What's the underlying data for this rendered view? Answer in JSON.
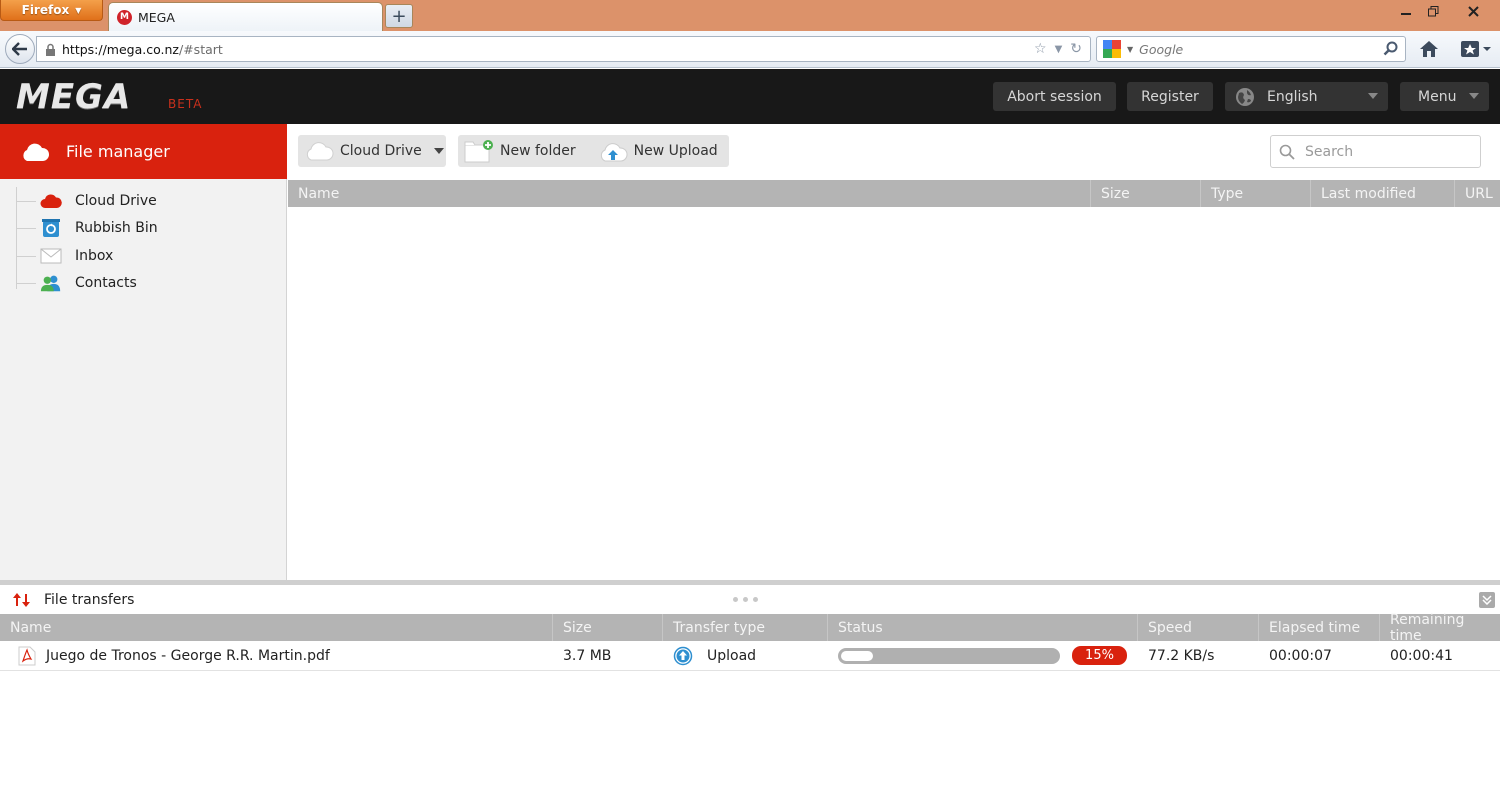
{
  "browser": {
    "menu_button": "Firefox",
    "tab_title": "MEGA",
    "tab_favicon": "M",
    "new_tab": "+",
    "url_host": "https://mega.co.nz",
    "url_path": "/#start",
    "search_placeholder": "Google"
  },
  "header": {
    "logo": "MEGA",
    "beta": "BETA",
    "abort_session": "Abort session",
    "register": "Register",
    "language": "English",
    "menu": "Menu"
  },
  "sidebar": {
    "title": "File manager",
    "items": [
      {
        "label": "Cloud Drive",
        "icon": "cloud-icon"
      },
      {
        "label": "Rubbish Bin",
        "icon": "recycle-icon"
      },
      {
        "label": "Inbox",
        "icon": "envelope-icon"
      },
      {
        "label": "Contacts",
        "icon": "contacts-icon"
      }
    ]
  },
  "toolbar": {
    "location": "Cloud Drive",
    "new_folder": "New folder",
    "new_upload": "New Upload",
    "search_placeholder": "Search"
  },
  "file_list": {
    "columns": [
      "Name",
      "Size",
      "Type",
      "Last modified",
      "URL"
    ]
  },
  "transfers": {
    "title": "File transfers",
    "columns": [
      "Name",
      "Size",
      "Transfer type",
      "Status",
      "Speed",
      "Elapsed time",
      "Remaining time"
    ],
    "rows": [
      {
        "name": "Juego de Tronos - George R.R. Martin.pdf",
        "size": "3.7 MB",
        "type": "Upload",
        "progress_fraction": 0.15,
        "progress_label": "15%",
        "speed": "77.2 KB/s",
        "elapsed": "00:00:07",
        "remaining": "00:00:41"
      }
    ]
  },
  "colors": {
    "brand_red": "#d9220e",
    "header_bg": "#181818",
    "column_header_bg": "#b4b4b4"
  }
}
